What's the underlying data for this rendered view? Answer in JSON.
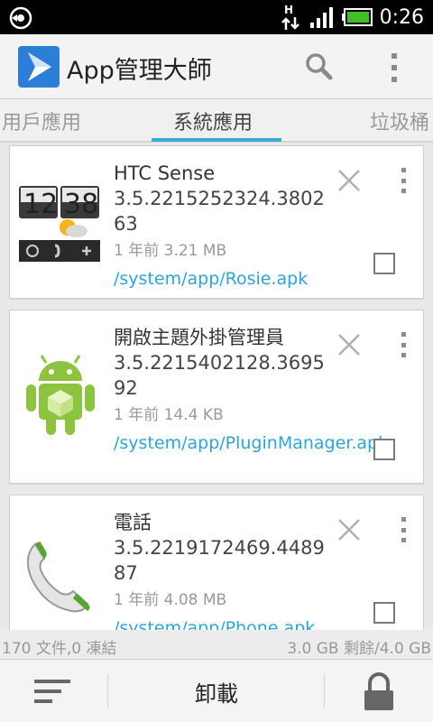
{
  "status_bar": {
    "time": "0:26",
    "network_label": "H"
  },
  "app_bar": {
    "title": "App管理大師",
    "icons": [
      "app-logo-icon",
      "search-icon",
      "overflow-menu-icon"
    ]
  },
  "tabs": [
    {
      "label": "用戶應用",
      "selected": false
    },
    {
      "label": "系統應用",
      "selected": true
    },
    {
      "label": "垃圾桶",
      "selected": false
    }
  ],
  "apps": [
    {
      "name": "HTC Sense",
      "version": "3.5.2215252324.380263",
      "meta": "1 年前 3.21 MB",
      "path": "/system/app/Rosie.apk",
      "icon": "htc-clock-weather-icon",
      "checked": false
    },
    {
      "name": "開啟主題外掛管理員",
      "version": "3.5.2215402128.369592",
      "meta": "1 年前 14.4 KB",
      "path": "/system/app/PluginManager.apk",
      "icon": "android-robot-icon",
      "checked": false
    },
    {
      "name": "電話",
      "version": "3.5.2219172469.448987",
      "meta": "1 年前 4.08 MB",
      "path": "/system/app/Phone.apk",
      "icon": "phone-handset-icon",
      "checked": false
    }
  ],
  "footer": {
    "file_summary": "170 文件,0 凍結",
    "storage_summary": "3.0 GB 剩餘/4.0 GB"
  },
  "action_bar": {
    "uninstall_label": "卸載",
    "icons": [
      "sort-icon",
      "lock-icon"
    ]
  },
  "colors": {
    "accent": "#38a9d9",
    "path_link": "#2aa6dc",
    "status_bar": "#000000",
    "battery": "#3fbf2a"
  }
}
